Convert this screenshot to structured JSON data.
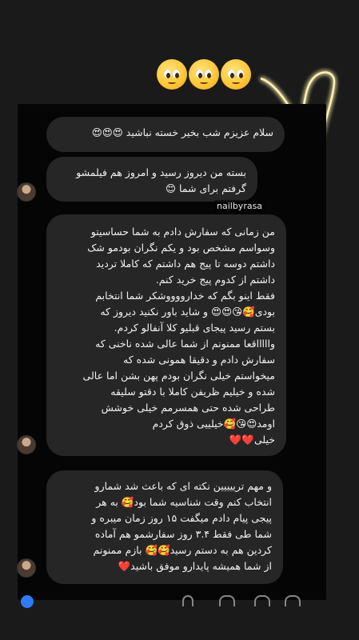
{
  "story": {
    "username": "nailbyrasa",
    "top_emoji_count": 3
  },
  "messages": [
    {
      "lines": [
        "سلام عزیزم شب بخیر خسته نباشید 😍😍😍"
      ]
    },
    {
      "lines": [
        "بسته من دیروز رسید و امروز هم فیلمشو",
        "گرفتم برای شما 😊"
      ]
    },
    {
      "lines": [
        "من زمانی که سفارش دادم به شما حساسیتو",
        "وسواسم مشخص بود و یکم نگران بودمو شک",
        "داشتم دوسه تا پیج هم داشتم که کاملا تردید",
        "داشتم از کدوم پیج خرید کنم.",
        "فقط اینو بگم که خدارووووشکر شما انتخابم",
        "بودی🥰😘😍😍 و شاید باور نکنید دیروز که",
        "بستم رسید پیجای قبلیو کلا آنفالو کردم.",
        "واااااقعا ممنونم از شما عالی شده ناخنی که",
        "سفارش دادم و دقیقا همونی شده که",
        "میخواستم خیلی نگران بودم پهن بشن اما عالی",
        "شده و خیلیم ظریفن کاملا با دقتو سلیقه",
        "طراحی شده حتی همسرمم خیلی خوشش",
        "اومد😍😘🥰خیلییی ذوق کردم",
        "خیلی❤️❤️"
      ]
    },
    {
      "lines": [
        "و مهم ترییییین نکته ای که باعث شد شمارو",
        "انتخاب کنم وقت شناسیه شما بود🥰 به هر",
        "پیجی پیام دادم میگفت ۱۵ روز زمان میبره و",
        "شما طی فقط ۳.۴ روز سفارشمو هم آماده",
        "کردین هم به دستم رسید🥰🥰 بازم ممنونم",
        "از شما همیشه پایدارو موفق باشید❤️"
      ]
    }
  ],
  "colors": {
    "background": "#1a1a1a",
    "chat_panel": "#050505",
    "bubble": "#262626",
    "heart_glow": "#ffd84a",
    "accent_blue": "#2f7bf6"
  },
  "icons": [
    "pleading-face-icon",
    "glowing-heart-icon",
    "avatar",
    "emoji-icon",
    "mic-icon",
    "gallery-icon",
    "sticker-icon"
  ]
}
